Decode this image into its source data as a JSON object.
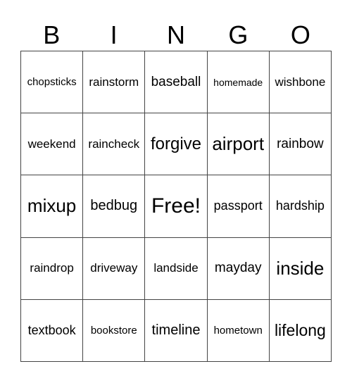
{
  "header": [
    "B",
    "I",
    "N",
    "G",
    "O"
  ],
  "cells": [
    {
      "text": "chopsticks",
      "size": 15
    },
    {
      "text": "rainstorm",
      "size": 17
    },
    {
      "text": "baseball",
      "size": 19
    },
    {
      "text": "homemade",
      "size": 14
    },
    {
      "text": "wishbone",
      "size": 17
    },
    {
      "text": "weekend",
      "size": 17
    },
    {
      "text": "raincheck",
      "size": 17
    },
    {
      "text": "forgive",
      "size": 24
    },
    {
      "text": "airport",
      "size": 26
    },
    {
      "text": "rainbow",
      "size": 19
    },
    {
      "text": "mixup",
      "size": 26
    },
    {
      "text": "bedbug",
      "size": 20
    },
    {
      "text": "Free!",
      "size": 30
    },
    {
      "text": "passport",
      "size": 18
    },
    {
      "text": "hardship",
      "size": 18
    },
    {
      "text": "raindrop",
      "size": 17
    },
    {
      "text": "driveway",
      "size": 17
    },
    {
      "text": "landside",
      "size": 17
    },
    {
      "text": "mayday",
      "size": 19
    },
    {
      "text": "inside",
      "size": 26
    },
    {
      "text": "textbook",
      "size": 18
    },
    {
      "text": "bookstore",
      "size": 15
    },
    {
      "text": "timeline",
      "size": 20
    },
    {
      "text": "hometown",
      "size": 15
    },
    {
      "text": "lifelong",
      "size": 23
    }
  ]
}
